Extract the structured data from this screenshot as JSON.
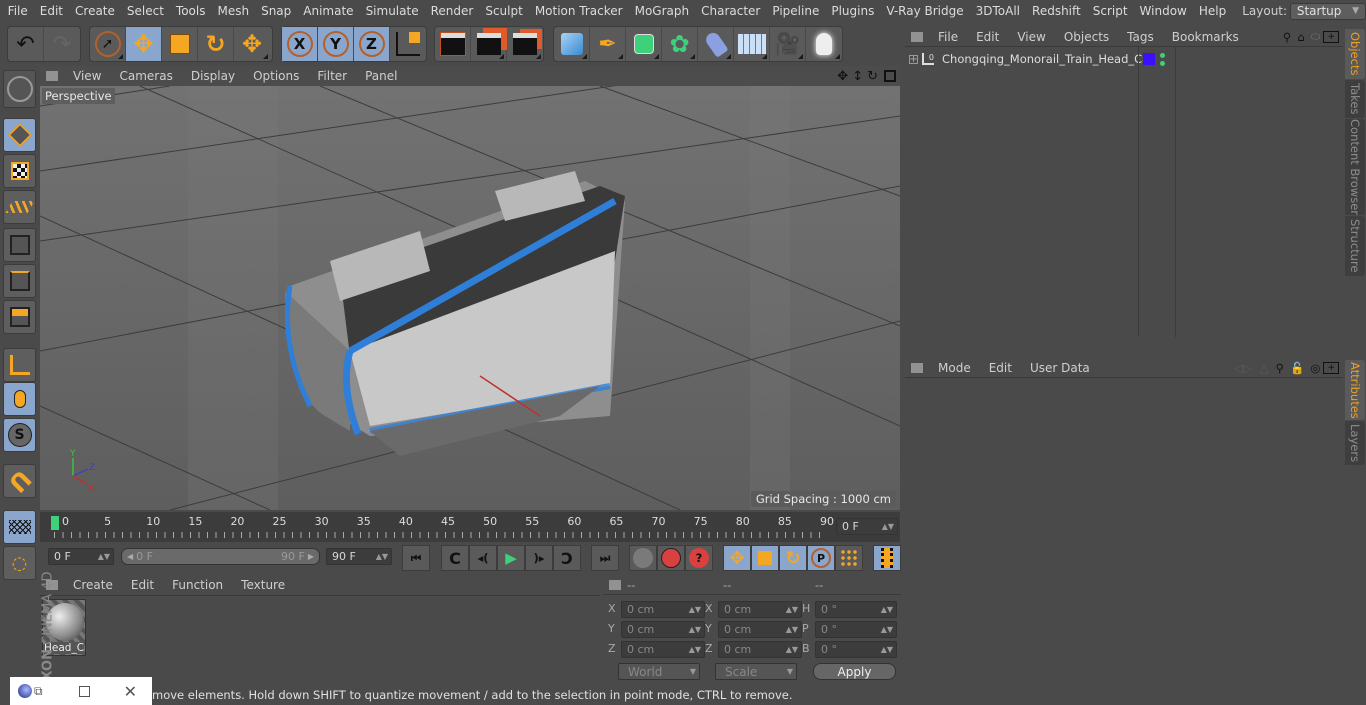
{
  "menubar": {
    "items": [
      "File",
      "Edit",
      "Create",
      "Select",
      "Tools",
      "Mesh",
      "Snap",
      "Animate",
      "Simulate",
      "Render",
      "Sculpt",
      "Motion Tracker",
      "MoGraph",
      "Character",
      "Pipeline",
      "Plugins",
      "V-Ray Bridge",
      "3DToAll",
      "Redshift",
      "Script",
      "Window",
      "Help"
    ],
    "layout_label": "Layout:",
    "layout_value": "Startup"
  },
  "toolbar": {
    "icons": [
      "undo-icon",
      "redo-icon",
      "live-selection-icon",
      "move-icon",
      "scale-icon",
      "rotate-icon",
      "move-recent-icon",
      "x-axis-lock-icon",
      "y-axis-lock-icon",
      "z-axis-lock-icon",
      "coordinate-system-icon",
      "render-view-icon",
      "render-picture-viewer-icon",
      "render-settings-icon",
      "cube-icon",
      "pen-spline-icon",
      "subdivision-icon",
      "array-cloner-icon",
      "deformer-bend-icon",
      "floor-icon",
      "camera-icon",
      "light-icon"
    ]
  },
  "left_tools": [
    "make-editable-icon",
    "model-mode-icon",
    "texture-mode-icon",
    "workplane-mode-icon",
    "points-mode-icon",
    "edges-mode-icon",
    "polygons-mode-icon",
    "axis-mode-icon",
    "tweak-mode-icon",
    "solo-icon",
    "snap-magnet-icon",
    "workplane-lock-icon",
    "workplane-align-icon"
  ],
  "viewport": {
    "menu": [
      "View",
      "Cameras",
      "Display",
      "Options",
      "Filter",
      "Panel"
    ],
    "label": "Perspective",
    "grid_spacing": "Grid Spacing : 1000 cm",
    "axis_labels": {
      "x": "X",
      "y": "Y",
      "z": "Z"
    }
  },
  "timeline": {
    "ticks": [
      "0",
      "5",
      "10",
      "15",
      "20",
      "25",
      "30",
      "35",
      "40",
      "45",
      "50",
      "55",
      "60",
      "65",
      "70",
      "75",
      "80",
      "85",
      "90"
    ],
    "current_frame": "0 F",
    "start_frame": "0 F",
    "range_start": "0 F",
    "range_end": "90 F",
    "end_frame": "90 F"
  },
  "material_manager": {
    "menu": [
      "Create",
      "Edit",
      "Function",
      "Texture"
    ],
    "materials": [
      {
        "name": "Head_Ca"
      }
    ]
  },
  "coordinates": {
    "headers": [
      "--",
      "--",
      "--"
    ],
    "rows": [
      {
        "l1": "X",
        "v1": "0 cm",
        "l2": "X",
        "v2": "0 cm",
        "l3": "H",
        "v3": "0 °"
      },
      {
        "l1": "Y",
        "v1": "0 cm",
        "l2": "Y",
        "v2": "0 cm",
        "l3": "P",
        "v3": "0 °"
      },
      {
        "l1": "Z",
        "v1": "0 cm",
        "l2": "Z",
        "v2": "0 cm",
        "l3": "B",
        "v3": "0 °"
      }
    ],
    "mode": "World",
    "transform": "Scale",
    "apply_label": "Apply"
  },
  "object_manager": {
    "menu": [
      "File",
      "Edit",
      "View",
      "Objects",
      "Tags",
      "Bookmarks"
    ],
    "objects": [
      {
        "name": "Chongqing_Monorail_Train_Head_Car",
        "color": "#3a10ff"
      }
    ]
  },
  "attributes": {
    "menu": [
      "Mode",
      "Edit",
      "User Data"
    ]
  },
  "side_tabs_top": [
    {
      "label": "Objects",
      "active": true
    },
    {
      "label": "Takes",
      "active": false
    },
    {
      "label": "Content Browser",
      "active": false
    },
    {
      "label": "Structure",
      "active": false
    }
  ],
  "side_tabs_bottom": [
    {
      "label": "Attributes",
      "active": true
    },
    {
      "label": "Layers",
      "active": false
    }
  ],
  "brand": {
    "maxon": "MAXON",
    "product": "CINEMA 4D"
  },
  "status": {
    "text": "move elements. Hold down SHIFT to quantize movement / add to the selection in point mode, CTRL to remove."
  }
}
